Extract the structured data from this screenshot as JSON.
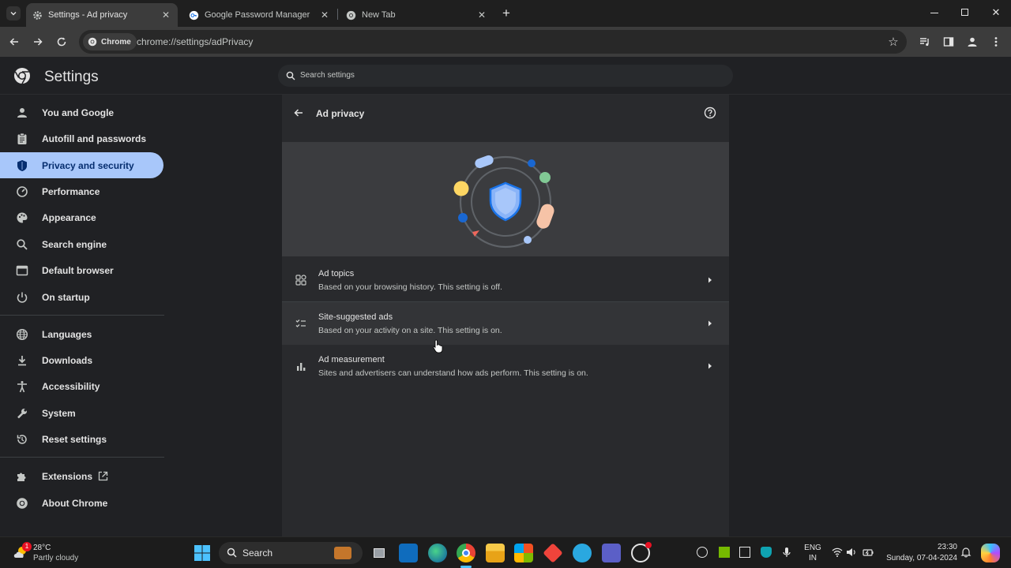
{
  "tabs": [
    {
      "title": "Settings - Ad privacy",
      "active": true
    },
    {
      "title": "Google Password Manager",
      "active": false
    },
    {
      "title": "New Tab",
      "active": false
    }
  ],
  "toolbar": {
    "chip_label": "Chrome",
    "url": "chrome://settings/adPrivacy"
  },
  "settings": {
    "title": "Settings",
    "search_placeholder": "Search settings"
  },
  "sidebar": {
    "items": [
      {
        "label": "You and Google",
        "icon": "person-icon"
      },
      {
        "label": "Autofill and passwords",
        "icon": "clipboard-icon"
      },
      {
        "label": "Privacy and security",
        "icon": "shield-icon",
        "selected": true
      },
      {
        "label": "Performance",
        "icon": "speedometer-icon"
      },
      {
        "label": "Appearance",
        "icon": "palette-icon"
      },
      {
        "label": "Search engine",
        "icon": "search-icon"
      },
      {
        "label": "Default browser",
        "icon": "browser-icon"
      },
      {
        "label": "On startup",
        "icon": "power-icon"
      },
      {
        "label": "Languages",
        "icon": "globe-icon"
      },
      {
        "label": "Downloads",
        "icon": "download-icon"
      },
      {
        "label": "Accessibility",
        "icon": "accessibility-icon"
      },
      {
        "label": "System",
        "icon": "wrench-icon"
      },
      {
        "label": "Reset settings",
        "icon": "reset-icon"
      },
      {
        "label": "Extensions",
        "icon": "puzzle-icon"
      },
      {
        "label": "About Chrome",
        "icon": "chrome-icon"
      }
    ]
  },
  "page": {
    "title": "Ad privacy",
    "rows": [
      {
        "title": "Ad topics",
        "subtitle": "Based on your browsing history. This setting is off.",
        "icon": "topics-icon"
      },
      {
        "title": "Site-suggested ads",
        "subtitle": "Based on your activity on a site. This setting is on.",
        "icon": "checklist-icon"
      },
      {
        "title": "Ad measurement",
        "subtitle": "Sites and advertisers can understand how ads perform. This setting is on.",
        "icon": "bar-chart-icon"
      }
    ]
  },
  "taskbar": {
    "weather_temp": "28°C",
    "weather_desc": "Partly cloudy",
    "weather_badge": "1",
    "search_label": "Search",
    "lang_top": "ENG",
    "lang_bottom": "IN",
    "time": "23:30",
    "date": "Sunday, 07-04-2024"
  },
  "colors": {
    "accent": "#a8c7fa",
    "selected_text": "#062e6f",
    "background": "#202124",
    "card": "#292a2d"
  }
}
